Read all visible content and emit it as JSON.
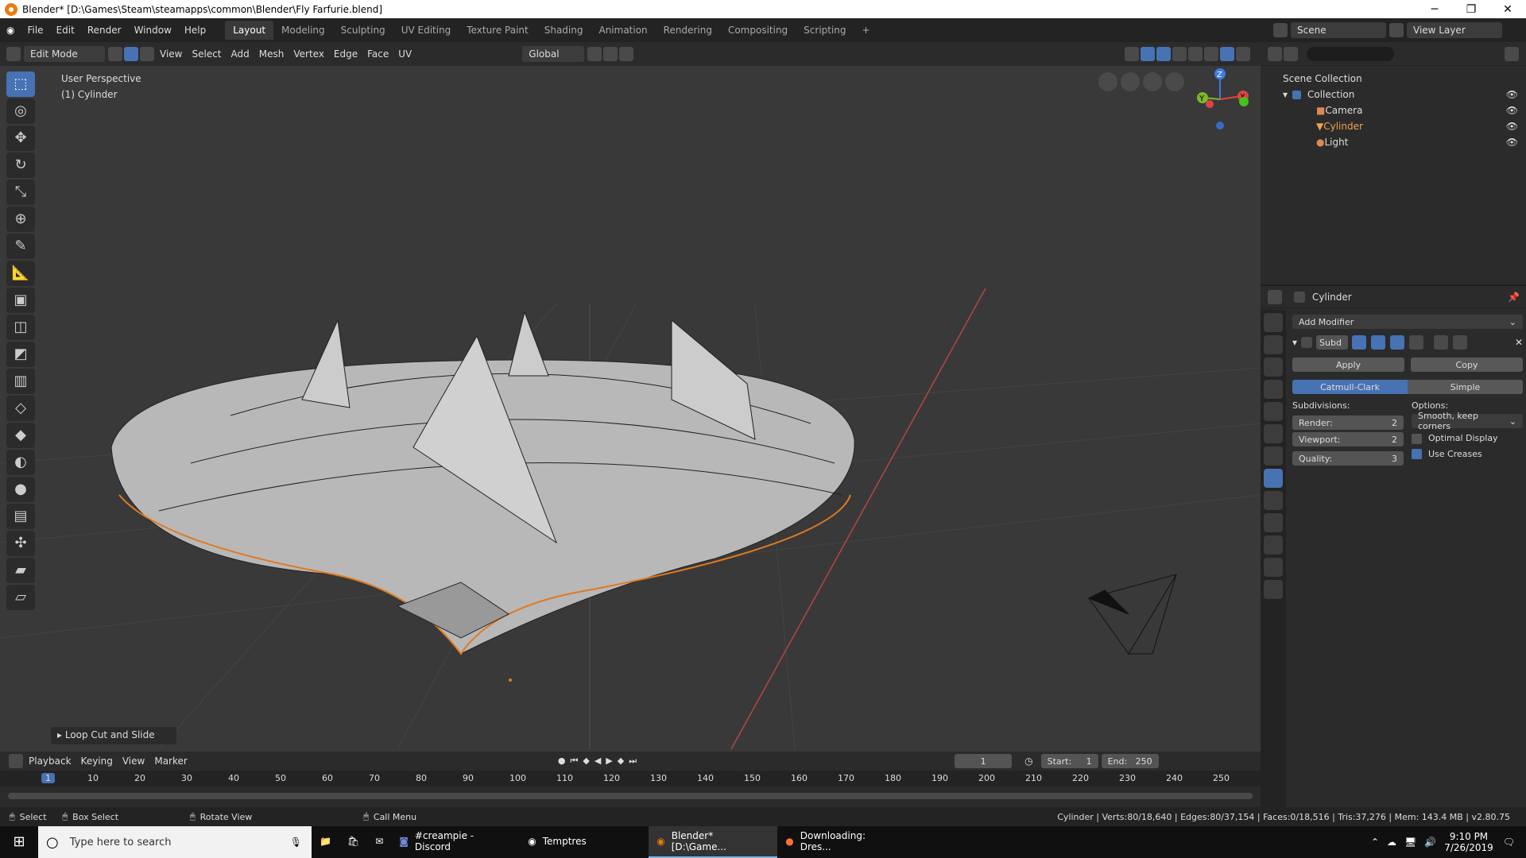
{
  "window": {
    "title": "Blender* [D:\\Games\\Steam\\steamapps\\common\\Blender\\Fly Farfurie.blend]"
  },
  "menus": [
    "File",
    "Edit",
    "Render",
    "Window",
    "Help"
  ],
  "workspaces": [
    "Layout",
    "Modeling",
    "Sculpting",
    "UV Editing",
    "Texture Paint",
    "Shading",
    "Animation",
    "Rendering",
    "Compositing",
    "Scripting"
  ],
  "scene": "Scene",
  "view_layer": "View Layer",
  "header3d": {
    "mode": "Edit Mode",
    "menus": [
      "View",
      "Select",
      "Add",
      "Mesh",
      "Vertex",
      "Edge",
      "Face",
      "UV"
    ],
    "transform": "Global"
  },
  "viewport": {
    "perspective": "User Perspective",
    "object": "(1) Cylinder",
    "gizmo_x": "X",
    "gizmo_y": "Y",
    "gizmo_z": "Z"
  },
  "operator_panel": "Loop Cut and Slide",
  "outliner": {
    "root": "Scene Collection",
    "collection": "Collection",
    "items": [
      "Camera",
      "Cylinder",
      "Light"
    ]
  },
  "properties": {
    "object": "Cylinder",
    "add_modifier": "Add Modifier",
    "mod_name": "Subd",
    "apply": "Apply",
    "copy": "Copy",
    "catmull": "Catmull-Clark",
    "simple": "Simple",
    "subdivisions_label": "Subdivisions:",
    "options_label": "Options:",
    "render_label": "Render:",
    "render_val": "2",
    "viewport_label": "Viewport:",
    "viewport_val": "2",
    "quality_label": "Quality:",
    "quality_val": "3",
    "uv_smooth": "Smooth, keep corners",
    "optimal": "Optimal Display",
    "creases": "Use Creases"
  },
  "timeline": {
    "menus": [
      "Playback",
      "Keying",
      "View",
      "Marker"
    ],
    "current": "1",
    "start_label": "Start:",
    "start": "1",
    "end_label": "End:",
    "end": "250",
    "ticks": [
      "1",
      "10",
      "20",
      "30",
      "40",
      "50",
      "60",
      "70",
      "80",
      "90",
      "100",
      "110",
      "120",
      "130",
      "140",
      "150",
      "160",
      "170",
      "180",
      "190",
      "200",
      "210",
      "220",
      "230",
      "240",
      "250"
    ]
  },
  "status": {
    "select": "Select",
    "box": "Box Select",
    "rotate": "Rotate View",
    "call": "Call Menu",
    "stats": "Cylinder | Verts:80/18,640 | Edges:80/37,154 | Faces:0/18,516 | Tris:37,276 | Mem: 143.4 MB | v2.80.75"
  },
  "taskbar": {
    "search": "Type here to search",
    "apps": [
      "#creampie - Discord",
      "Temptres",
      "Blender* [D:\\Game...",
      "Downloading: Dres..."
    ],
    "time": "9:10 PM",
    "date": "7/26/2019"
  }
}
